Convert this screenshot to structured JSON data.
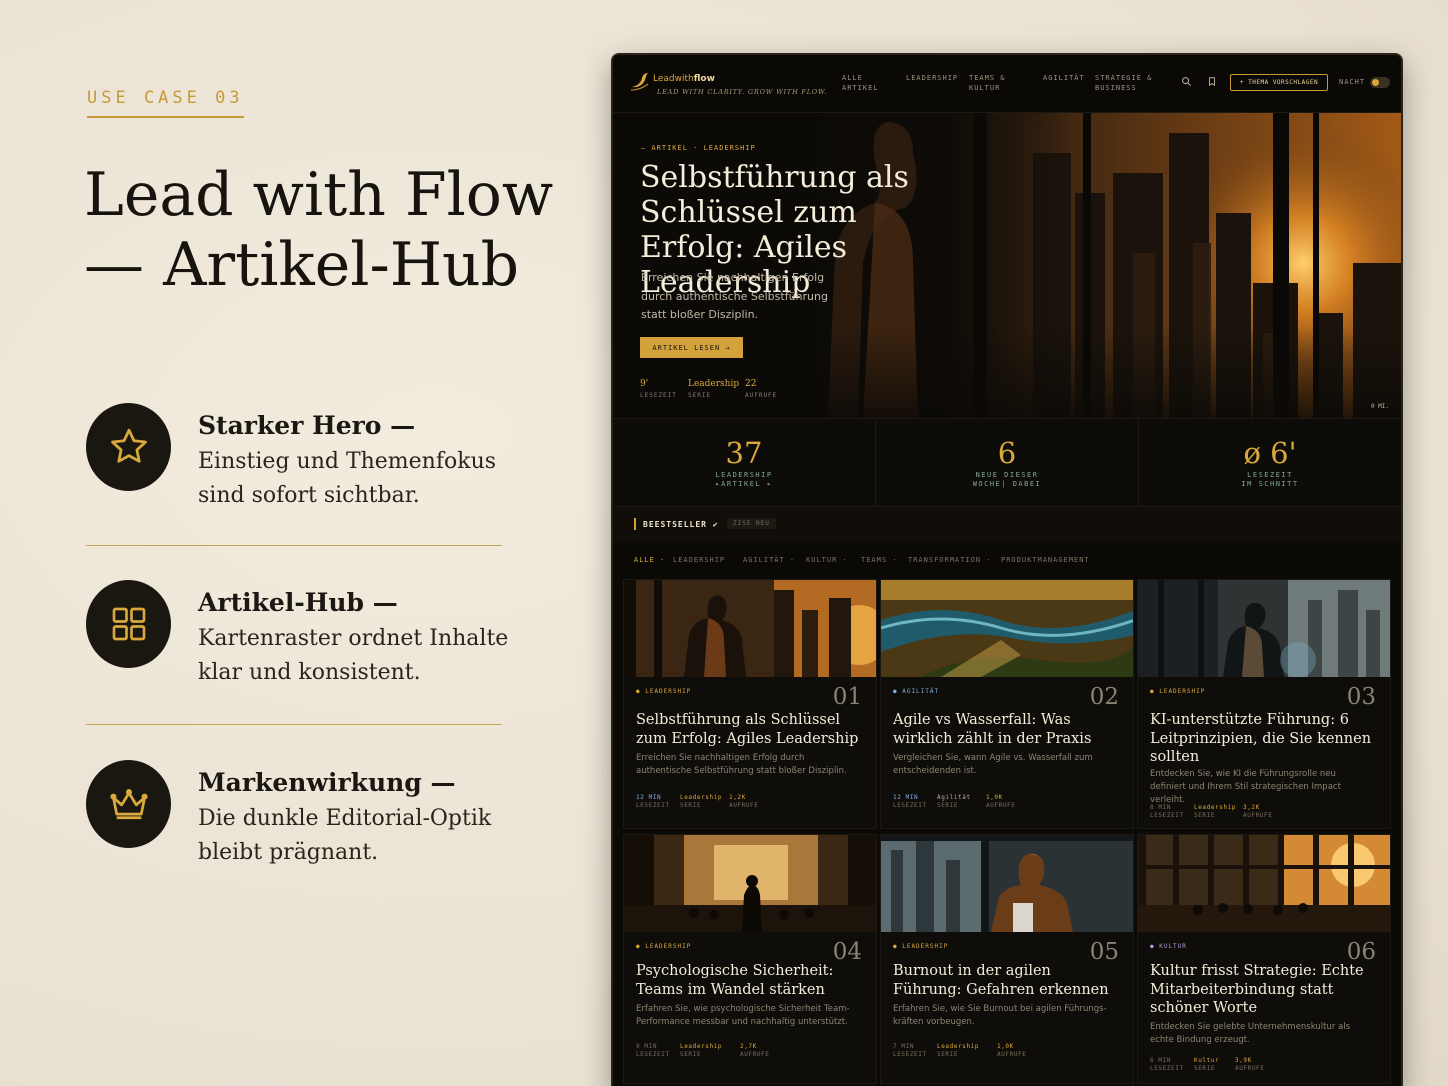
{
  "eyebrow": "USE CASE 03",
  "headline": "Lead with Flow — Artikel-Hub",
  "features": [
    {
      "icon": "star-icon",
      "title": "Starker Hero —",
      "desc": "Einstieg und Themenfokus sind sofort sichtbar."
    },
    {
      "icon": "grid-icon",
      "title": "Artikel-Hub —",
      "desc": "Kartenraster ordnet Inhalte klar und konsistent."
    },
    {
      "icon": "crown-icon",
      "title": "Markenwirkung —",
      "desc": "Die dunkle Editorial-Optik bleibt prägnant."
    }
  ],
  "mockup": {
    "logo": {
      "lead": "Leadwith",
      "flow": "flow"
    },
    "tagline": "LEAD WITH CLARITY. GROW WITH FLOW.",
    "nav": [
      "ALLE ARTIKEL",
      "LEADERSHIP",
      "TEAMS & KULTUR",
      "AGILITÄT",
      "STRATEGIE & BUSINESS"
    ],
    "cta": "+ THEMA VORSCHLAGEN",
    "night": "NACHT",
    "hero": {
      "kicker": "— ARTIKEL · LEADERSHIP",
      "title": "Selbstführung als Schlüssel zum Erfolg: Agiles Leadership",
      "lead": "Erreichen Sie nachhaltigen Erfolg durch authentische Selbstführung statt bloßer Disziplin.",
      "button": "ARTIKEL LESEN →",
      "stats": [
        {
          "value": "9'",
          "label": "LESEZEIT"
        },
        {
          "value": "Leadership",
          "label": "SERIE"
        },
        {
          "value": "22",
          "label": "AUFRUFE"
        }
      ],
      "caption": "0 MI."
    },
    "stats": [
      {
        "num": "37",
        "label": "LEADERSHIP ▸ARTIKEL ▸"
      },
      {
        "num": "6",
        "label": "NEUE DIESER WOCHE| DABEI"
      },
      {
        "num": "ø 6'",
        "label": "LESEZEIT IM SCHNITT"
      }
    ],
    "section": {
      "title": "BEESTSELLER ✔",
      "pill": "ZISE NEU"
    },
    "filters": [
      "ALLE ·",
      "LEADERSHIP",
      "AGILITÄT ·",
      "KULTUR ·",
      "TEAMS ·",
      "TRANSFORMATION ·",
      "PRODUKTMANAGEMENT"
    ],
    "cards": [
      {
        "tag": "● LEADERSHIP",
        "idx": "01",
        "title": "Selbstführung als Schlüssel zum Erfolg: Agiles Leadership",
        "excerpt": "Erreichen Sie nachhaltigen Erfolg durch authentische Selbstführung statt bloßer Disziplin.",
        "read": "12 MIN",
        "read_label": "LESEZEIT",
        "series": "Leadership",
        "series_label": "SERIE",
        "views": "1,2K",
        "views_label": "AUFRUFE"
      },
      {
        "tag": "● AGILITÄT",
        "idx": "02",
        "title": "Agile vs Wasserfall: Was wirklich zählt in der Praxis",
        "excerpt": "Vergleichen Sie, wann Agile vs. Wasserfall zum entscheidenden ist.",
        "read": "12 MIN",
        "read_label": "LESEZEIT",
        "series": "Agilität",
        "series_label": "SERIE",
        "views": "1,0K",
        "views_label": "AUFRUFE"
      },
      {
        "tag": "● LEADERSHIP",
        "idx": "03",
        "title": "KI-unterstützte Führung: 6 Leitprinzipien, die Sie kennen sollten",
        "excerpt": "Entdecken Sie, wie KI die Führungsrolle neu definiert und Ihrem Stil strategischen Impact verleiht.",
        "read": "8 MIN",
        "read_label": "LESEZEIT",
        "series": "Leadership",
        "series_label": "SERIE",
        "views": "3,2K",
        "views_label": "AUFRUFE"
      },
      {
        "tag": "● LEADERSHIP",
        "idx": "04",
        "title": "Psychologische Sicherheit: Teams im Wandel stärken",
        "excerpt": "Erfahren Sie, wie psychologische Sicherheit Team-Performance messbar und nachhaltig unterstützt.",
        "read": "9 MIN",
        "read_label": "LESEZEIT",
        "series": "Leadership",
        "series_label": "SERIE",
        "views": "2,7K",
        "views_label": "AUFRUFE"
      },
      {
        "tag": "● LEADERSHIP",
        "idx": "05",
        "title": "Burnout in der agilen Führung: Gefahren erkennen",
        "excerpt": "Erfahren Sie, wie Sie Burnout bei agilen Führungs-kräften vorbeugen.",
        "read": "7 MIN",
        "read_label": "LESEZEIT",
        "series": "Leadership",
        "series_label": "SERIE",
        "views": "1,0K",
        "views_label": "AUFRUFE"
      },
      {
        "tag": "● KULTUR",
        "idx": "06",
        "title": "Kultur frisst Strategie: Echte Mitarbeiterbindung statt schöner Worte",
        "excerpt": "Entdecken Sie gelebte Unternehmenskultur als echte Bindung erzeugt.",
        "read": "6 MIN",
        "read_label": "LESEZEIT",
        "series": "Kultur",
        "series_label": "SERIE",
        "views": "3,9K",
        "views_label": "AUFRUFE"
      }
    ]
  },
  "colors": {
    "accent": "#d9a93c",
    "paper": "#ede6d9",
    "ink": "#17140f",
    "dark": "#0c0a07",
    "stat_label": "#7fa894"
  }
}
